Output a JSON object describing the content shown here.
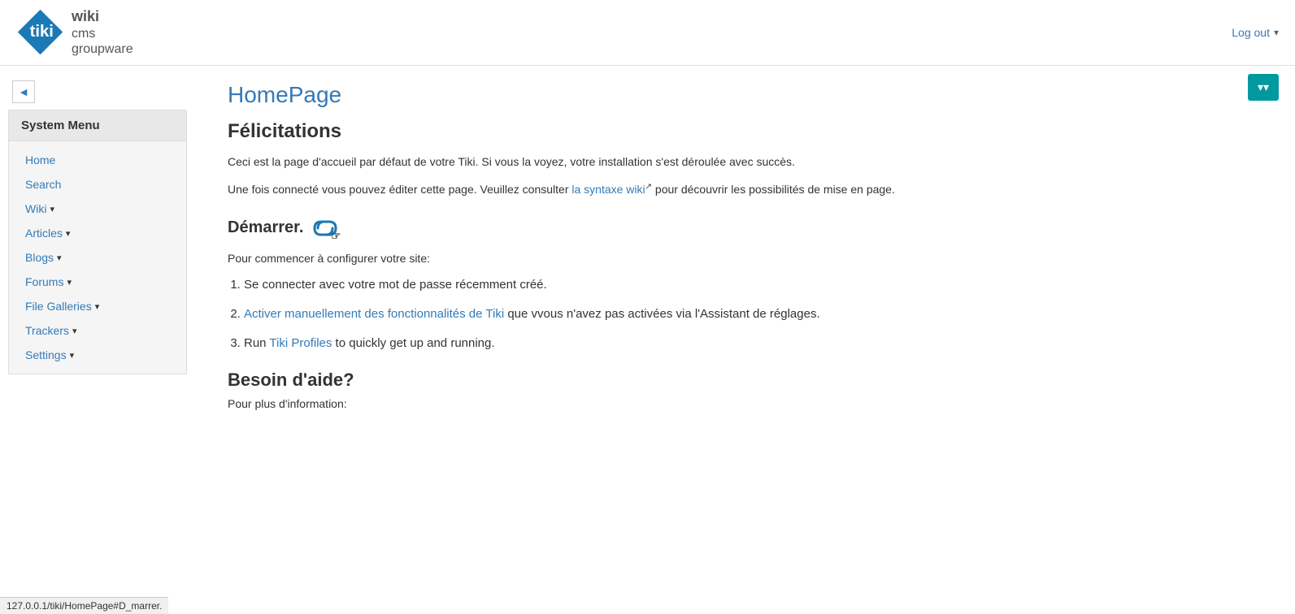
{
  "header": {
    "logout_label": "Log out",
    "dropdown_arrow": "▾"
  },
  "logo": {
    "wiki": "wiki",
    "cms": "cms",
    "groupware": "groupware",
    "tiki": "tiki",
    "registered": "®"
  },
  "sidebar": {
    "collapse_icon": "◄",
    "system_menu_title": "System Menu",
    "items": [
      {
        "label": "Home",
        "has_arrow": false
      },
      {
        "label": "Search",
        "has_arrow": false
      },
      {
        "label": "Wiki",
        "has_arrow": true
      },
      {
        "label": "Articles",
        "has_arrow": true
      },
      {
        "label": "Blogs",
        "has_arrow": true
      },
      {
        "label": "Forums",
        "has_arrow": true
      },
      {
        "label": "File Galleries",
        "has_arrow": true
      },
      {
        "label": "Trackers",
        "has_arrow": true
      },
      {
        "label": "Settings",
        "has_arrow": true
      }
    ]
  },
  "float_button": {
    "label": "▾▾"
  },
  "main": {
    "page_title": "HomePage",
    "section1_title": "Félicitations",
    "intro1": "Ceci est la page d'accueil par défaut de votre Tiki. Si vous la voyez, votre installation s'est déroulée avec succès.",
    "intro2_before": "Une fois connecté vous pouvez éditer cette page. Veuillez consulter ",
    "intro2_link": "la syntaxe wiki",
    "intro2_link_icon": "↗",
    "intro2_after": " pour découvrir les possibilités de mise en page.",
    "section2_title": "Démarrer.",
    "section2_para": "Pour commencer à configurer votre site:",
    "list_items": [
      {
        "number": "1.",
        "text": "Se connecter avec votre mot de passe récemment créé.",
        "link": null
      },
      {
        "number": "2.",
        "text_before": "",
        "link": "Activer manuellement des fonctionnalités de Tiki",
        "text_after": " que vvous n'avez pas activées via l'Assistant de réglages."
      },
      {
        "number": "3.",
        "text_before": "Run ",
        "link": "Tiki Profiles",
        "text_after": " to quickly get up and running."
      }
    ],
    "section3_title": "Besoin d'aide?",
    "section3_para": "Pour plus d'information:"
  },
  "statusbar": {
    "url": "127.0.0.1/tiki/HomePage#D_marrer."
  }
}
